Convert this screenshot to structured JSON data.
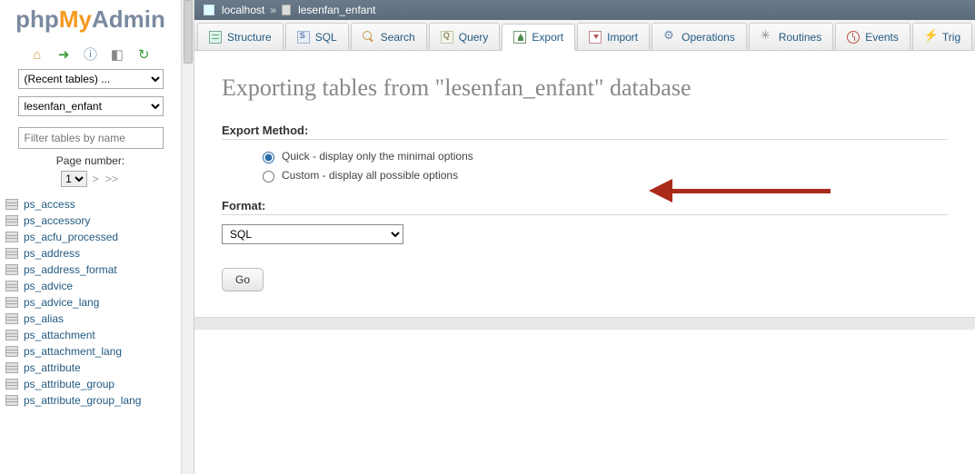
{
  "logo": {
    "part1": "php",
    "part2": "My",
    "part3": "Admin"
  },
  "sidebar": {
    "recent_label": "(Recent tables) ...",
    "db_name": "lesenfan_enfant",
    "filter_placeholder": "Filter tables by name",
    "page_number_label": "Page number:",
    "page_number_value": "1",
    "pager_next": ">",
    "pager_last": ">>",
    "tables": [
      "ps_access",
      "ps_accessory",
      "ps_acfu_processed",
      "ps_address",
      "ps_address_format",
      "ps_advice",
      "ps_advice_lang",
      "ps_alias",
      "ps_attachment",
      "ps_attachment_lang",
      "ps_attribute",
      "ps_attribute_group",
      "ps_attribute_group_lang"
    ]
  },
  "breadcrumb": {
    "server": "localhost",
    "separator": "»",
    "database": "lesenfan_enfant"
  },
  "tabs": [
    {
      "id": "structure",
      "label": "Structure"
    },
    {
      "id": "sql",
      "label": "SQL"
    },
    {
      "id": "search",
      "label": "Search"
    },
    {
      "id": "query",
      "label": "Query"
    },
    {
      "id": "export",
      "label": "Export"
    },
    {
      "id": "import",
      "label": "Import"
    },
    {
      "id": "operations",
      "label": "Operations"
    },
    {
      "id": "routines",
      "label": "Routines"
    },
    {
      "id": "events",
      "label": "Events"
    },
    {
      "id": "triggers",
      "label": "Trig"
    }
  ],
  "page": {
    "title": "Exporting tables from \"lesenfan_enfant\" database",
    "export_method_label": "Export Method:",
    "quick_label": "Quick - display only the minimal options",
    "custom_label": "Custom - display all possible options",
    "format_label": "Format:",
    "format_value": "SQL",
    "go_label": "Go"
  }
}
